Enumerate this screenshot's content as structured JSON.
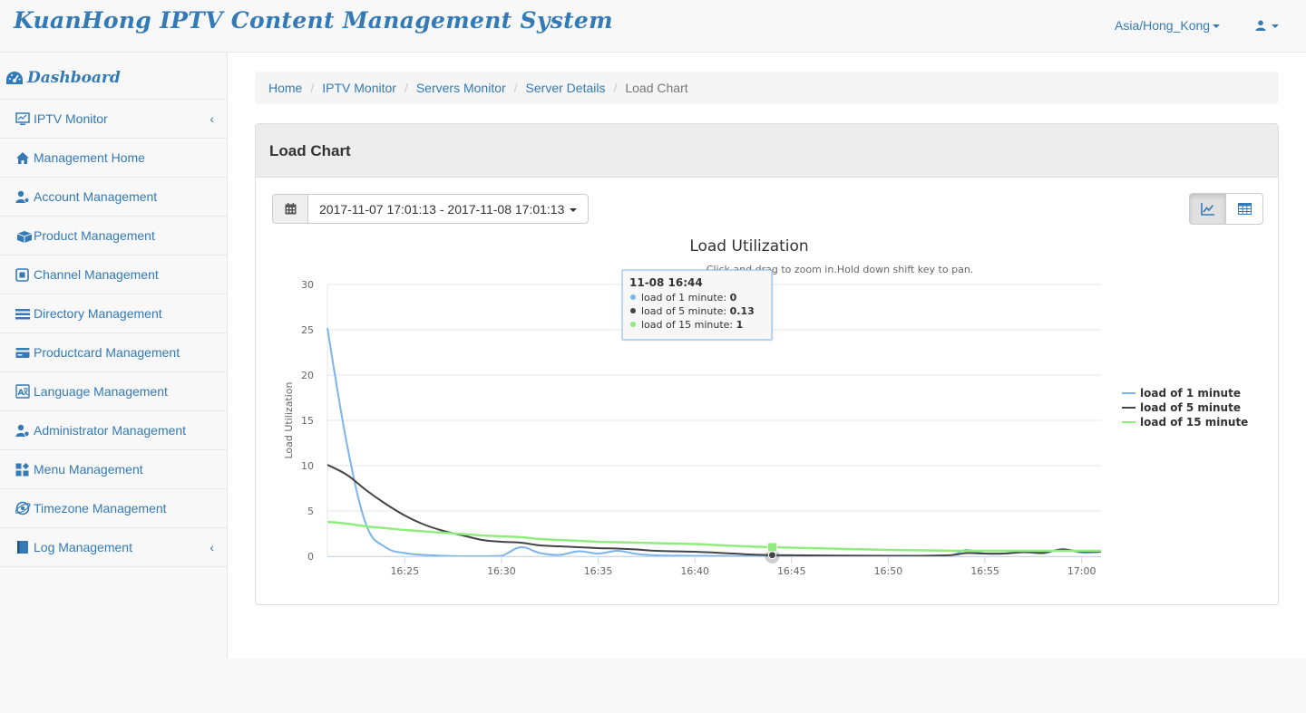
{
  "app": {
    "title": "KuanHong IPTV Content Management System",
    "timezone": "Asia/Hong_Kong"
  },
  "sidebar": {
    "dashboard": "Dashboard",
    "items": [
      {
        "label": "IPTV Monitor",
        "icon": "monitor-icon",
        "expandable": true
      },
      {
        "label": "Management Home",
        "icon": "home-icon",
        "expandable": false
      },
      {
        "label": "Account Management",
        "icon": "user-gear-icon",
        "expandable": false
      },
      {
        "label": "Product Management",
        "icon": "gift-icon",
        "expandable": false
      },
      {
        "label": "Channel Management",
        "icon": "channel-icon",
        "expandable": false
      },
      {
        "label": "Directory Management",
        "icon": "list-icon",
        "expandable": false
      },
      {
        "label": "Productcard Management",
        "icon": "card-icon",
        "expandable": false
      },
      {
        "label": "Language Management",
        "icon": "language-icon",
        "expandable": false
      },
      {
        "label": "Administrator Management",
        "icon": "admin-icon",
        "expandable": false
      },
      {
        "label": "Menu Management",
        "icon": "menu-icon",
        "expandable": false
      },
      {
        "label": "Timezone Management",
        "icon": "globe-icon",
        "expandable": false
      },
      {
        "label": "Log Management",
        "icon": "book-icon",
        "expandable": true
      }
    ],
    "collapse_glyph": "‹"
  },
  "breadcrumb": {
    "items": [
      "Home",
      "IPTV Monitor",
      "Servers Monitor",
      "Server Details"
    ],
    "active": "Load Chart",
    "separator": "/"
  },
  "panel": {
    "title": "Load Chart",
    "date_range": "2017-11-07 17:01:13 - 2017-11-08 17:01:13"
  },
  "chart_data": {
    "type": "line",
    "title": "Load Utilization",
    "subtitle": "Click and drag to zoom in.Hold down shift key to pan.",
    "ylabel": "Load Utilization",
    "xlabel": "",
    "ylim": [
      0,
      30
    ],
    "yticks": [
      0,
      5,
      10,
      15,
      20,
      25,
      30
    ],
    "xlim": [
      "16:21",
      "17:01"
    ],
    "xticks": [
      "16:25",
      "16:30",
      "16:35",
      "16:40",
      "16:45",
      "16:50",
      "16:55",
      "17:00"
    ],
    "grid": true,
    "legend": "right",
    "series": [
      {
        "name": "load of 1 minute",
        "color": "#7cb5ec",
        "x": [
          "16:21",
          "16:22",
          "16:23",
          "16:24",
          "16:25",
          "16:26",
          "16:27",
          "16:28",
          "16:29",
          "16:30",
          "16:31",
          "16:32",
          "16:33",
          "16:34",
          "16:35",
          "16:36",
          "16:37",
          "16:38",
          "16:40",
          "16:44",
          "16:50",
          "16:53",
          "16:54",
          "16:55",
          "16:56",
          "16:57",
          "16:58",
          "16:59",
          "17:00",
          "17:01"
        ],
        "values": [
          25.2,
          12.5,
          3.5,
          1.0,
          0.35,
          0.15,
          0.05,
          0,
          0,
          0.05,
          1.0,
          0.35,
          0.15,
          0.55,
          0.3,
          0.6,
          0.25,
          0.1,
          0.05,
          0,
          0,
          0.05,
          0.7,
          0.3,
          0.3,
          0.5,
          0.3,
          0.8,
          0.4,
          0.5
        ]
      },
      {
        "name": "load of 5 minute",
        "color": "#434348",
        "x": [
          "16:21",
          "16:22",
          "16:23",
          "16:24",
          "16:25",
          "16:26",
          "16:27",
          "16:28",
          "16:29",
          "16:30",
          "16:31",
          "16:32",
          "16:33",
          "16:34",
          "16:35",
          "16:36",
          "16:37",
          "16:38",
          "16:40",
          "16:42",
          "16:44",
          "16:50",
          "16:53",
          "16:54",
          "16:55",
          "16:56",
          "16:57",
          "16:58",
          "16:59",
          "17:00",
          "17:01"
        ],
        "values": [
          10.1,
          9.0,
          7.3,
          5.8,
          4.5,
          3.5,
          2.8,
          2.3,
          1.8,
          1.6,
          1.5,
          1.2,
          1.1,
          1.0,
          0.9,
          0.85,
          0.75,
          0.6,
          0.5,
          0.3,
          0.13,
          0.05,
          0.1,
          0.35,
          0.3,
          0.3,
          0.45,
          0.4,
          0.75,
          0.5,
          0.5
        ]
      },
      {
        "name": "load of 15 minute",
        "color": "#90ed7d",
        "x": [
          "16:21",
          "16:22",
          "16:23",
          "16:24",
          "16:25",
          "16:26",
          "16:27",
          "16:28",
          "16:29",
          "16:30",
          "16:31",
          "16:32",
          "16:33",
          "16:34",
          "16:35",
          "16:36",
          "16:37",
          "16:38",
          "16:40",
          "16:42",
          "16:44",
          "16:46",
          "16:48",
          "16:50",
          "16:52",
          "16:54",
          "16:56",
          "16:58",
          "17:00",
          "17:01"
        ],
        "values": [
          3.8,
          3.6,
          3.3,
          3.1,
          2.9,
          2.75,
          2.6,
          2.45,
          2.3,
          2.2,
          2.1,
          1.9,
          1.8,
          1.7,
          1.6,
          1.55,
          1.5,
          1.45,
          1.35,
          1.15,
          1.0,
          0.9,
          0.8,
          0.7,
          0.65,
          0.6,
          0.6,
          0.6,
          0.6,
          0.6
        ]
      }
    ],
    "tooltip": {
      "header": "11-08 16:44",
      "x": "16:44",
      "rows": [
        {
          "label": "load of 1 minute: ",
          "value": "0"
        },
        {
          "label": "load of 5 minute: ",
          "value": "0.13"
        },
        {
          "label": "load of 15 minute: ",
          "value": "1"
        }
      ]
    }
  }
}
